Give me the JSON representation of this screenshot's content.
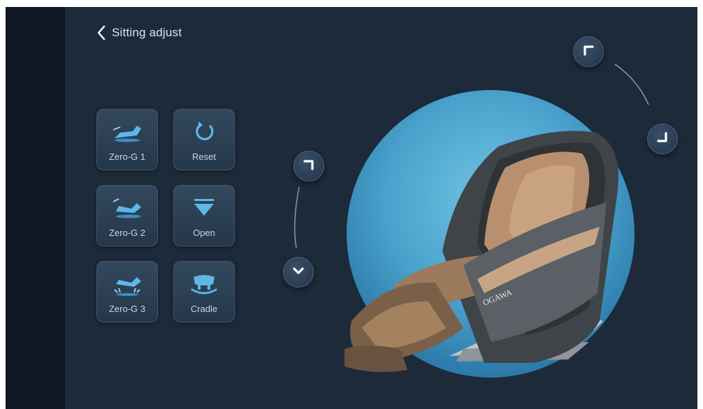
{
  "header": {
    "title": "Sitting adjust",
    "back_icon": "chevron-left-icon"
  },
  "modes": [
    {
      "label": "Zero-G 1",
      "icon": "recline-chair-1-icon"
    },
    {
      "label": "Reset",
      "icon": "reset-arrow-icon"
    },
    {
      "label": "Zero-G 2",
      "icon": "recline-chair-2-icon"
    },
    {
      "label": "Open",
      "icon": "triangle-down-icon"
    },
    {
      "label": "Zero-G 3",
      "icon": "recline-chair-3-icon"
    },
    {
      "label": "Cradle",
      "icon": "cradle-icon"
    }
  ],
  "chair": {
    "brand": "OGAWA"
  },
  "controls": {
    "backrest_up": "corner-up-icon",
    "backrest_down": "corner-down-icon",
    "legrest_up": "corner-up-right-icon",
    "legrest_down": "chevron-down-icon"
  },
  "colors": {
    "background": "#1d2a39",
    "accent": "#4aa8d8",
    "circle": "#4aa2cc"
  }
}
